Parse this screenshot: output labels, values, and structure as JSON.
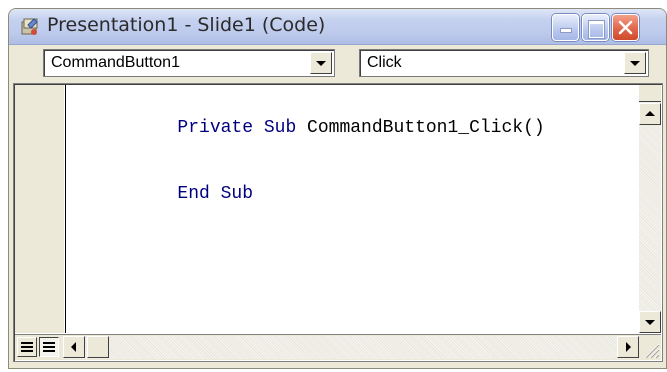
{
  "window": {
    "title": "Presentation1 - Slide1 (Code)",
    "icon": "vba-code-module-icon"
  },
  "toolbar": {
    "object_combo_value": "CommandButton1",
    "procedure_combo_value": "Click"
  },
  "code": {
    "lines": [
      {
        "keyword": "Private Sub ",
        "rest": "CommandButton1_Click()"
      },
      {
        "keyword": "End Sub",
        "rest": ""
      }
    ],
    "keyword_color": "#00007f"
  },
  "footer": {
    "procedure_view_icon": "procedure-view-icon",
    "full_module_view_icon": "full-module-view-icon"
  },
  "colors": {
    "window_face": "#ece9d8",
    "titlebar_inactive": "#c5d1ef",
    "close_button": "#e0664a"
  }
}
